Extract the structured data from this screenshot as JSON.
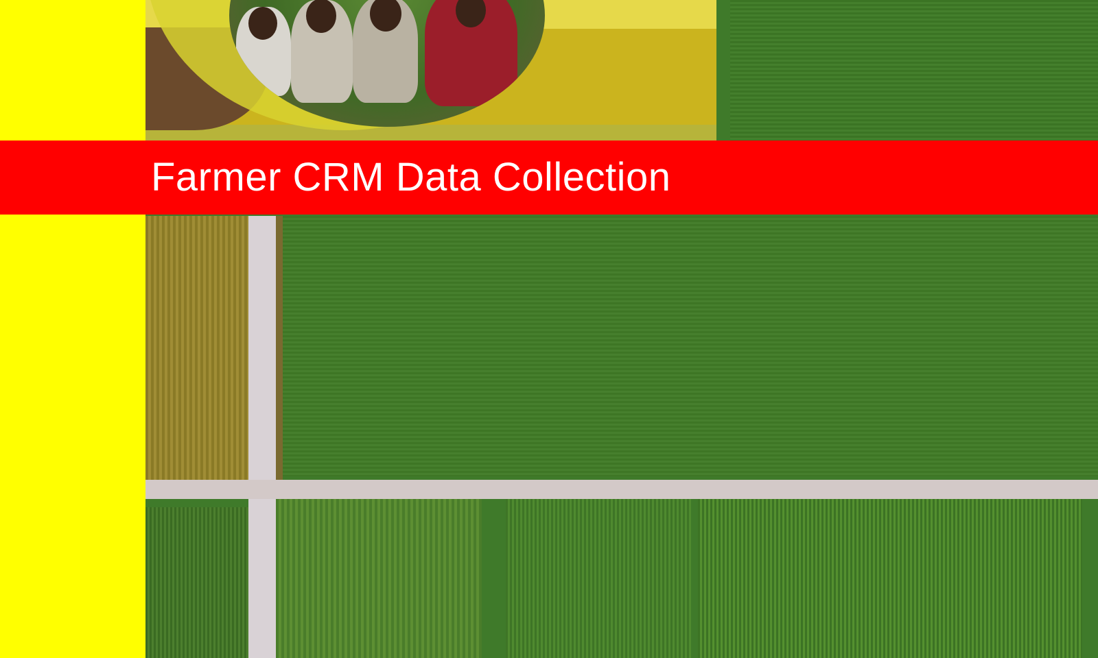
{
  "title": "Farmer CRM Data Collection",
  "colors": {
    "sidebar_yellow": "#ffff00",
    "title_band_red": "#ff0000",
    "title_text": "#ffffff",
    "field_green": "#3f7a2a"
  },
  "images": {
    "farmers_photo": "farmers-group-photo",
    "aerial_photo": "aerial-farm-fields-photo"
  }
}
